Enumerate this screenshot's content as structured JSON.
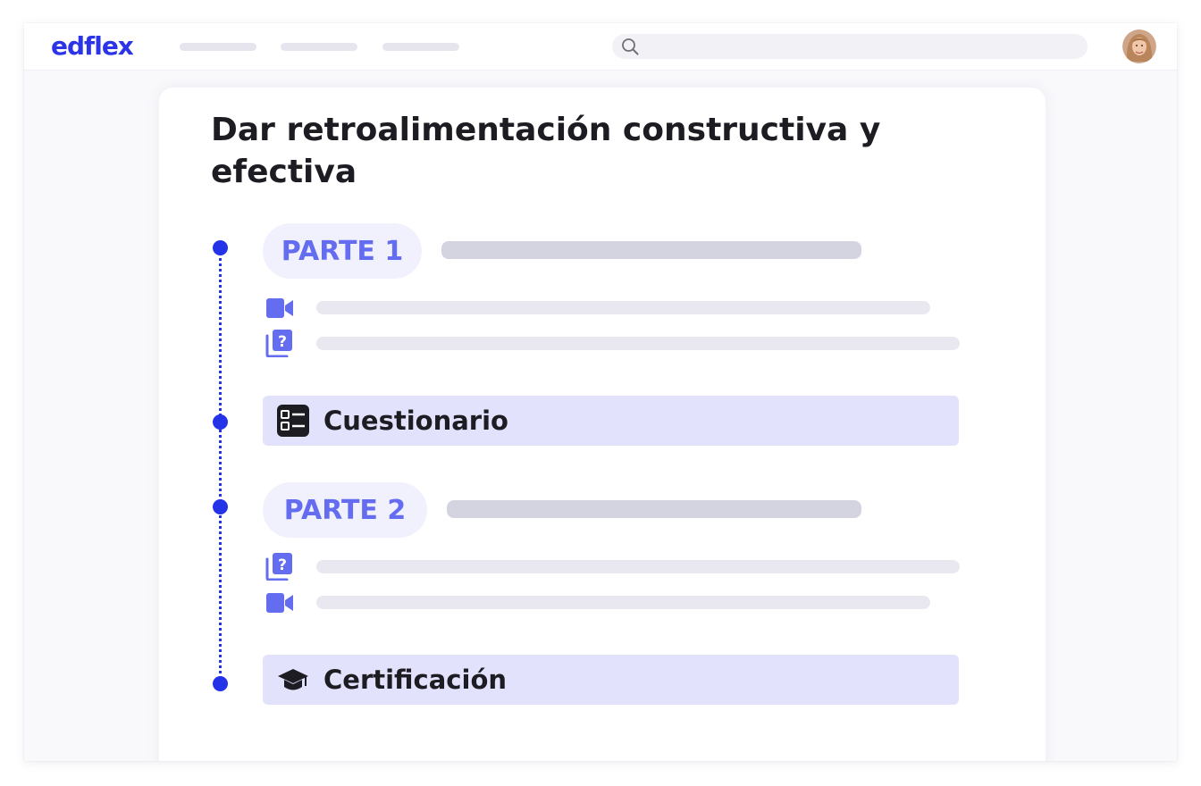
{
  "app": {
    "logo": "edflex",
    "search_icon": "search-icon",
    "avatar": "user-avatar"
  },
  "course": {
    "title": "Dar retroalimentación constructiva y efectiva",
    "timeline_color": "#2533e8",
    "parts": [
      {
        "label": "PARTE 1",
        "items": [
          {
            "icon": "video-icon"
          },
          {
            "icon": "quiz-icon"
          }
        ]
      },
      {
        "label": "PARTE 2",
        "items": [
          {
            "icon": "quiz-icon"
          },
          {
            "icon": "video-icon"
          }
        ]
      }
    ],
    "quiz": {
      "label": "Cuestionario",
      "icon": "checklist-icon"
    },
    "certification": {
      "label": "Certificación",
      "icon": "graduation-cap-icon"
    }
  },
  "colors": {
    "brand": "#2b34e6",
    "accent": "#646cf0",
    "section_bg": "#e2e2fc",
    "pill_bg": "#f1f0fd"
  }
}
